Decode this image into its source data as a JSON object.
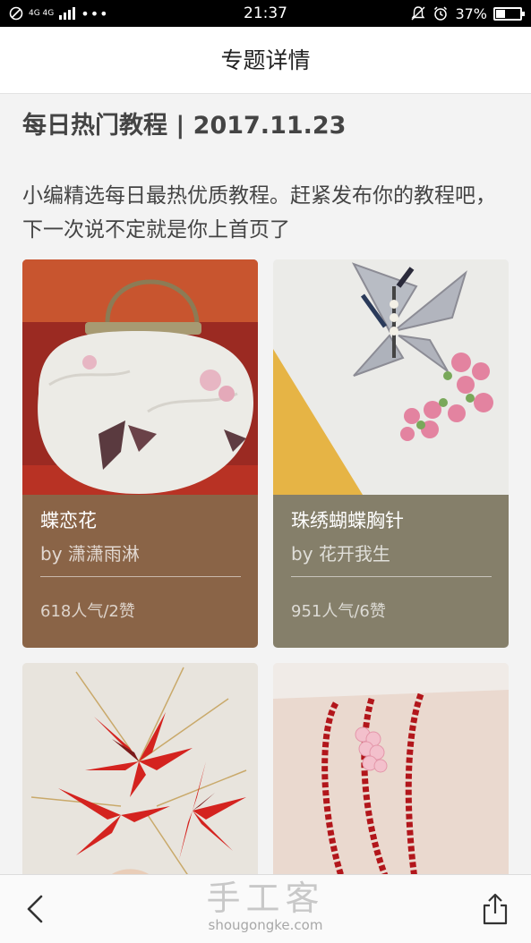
{
  "status_bar": {
    "network": "4G 4G",
    "time": "21:37",
    "battery": "37%",
    "battery_level": 0.37
  },
  "header": {
    "title": "专题详情",
    "back_icon": "chevron-left-icon",
    "share_icon": "share-icon"
  },
  "article": {
    "headline": "每日热门教程 | 2017.11.23",
    "intro": "小编精选每日最热优质教程。赶紧发布你的教程吧，下一次说不定就是你上首页了"
  },
  "cards": [
    {
      "title": "蝶恋花",
      "author": "by 潇潇雨淋",
      "stats": "618人气/2赞",
      "color": "#8a6447"
    },
    {
      "title": "珠绣蝴蝶胸针",
      "author": "by 花开我生",
      "stats": "951人气/6赞",
      "color": "#857f6a"
    },
    {
      "title": "",
      "author": "",
      "stats": "",
      "color": "#a33"
    },
    {
      "title": "",
      "author": "",
      "stats": "",
      "color": "#c62a2a"
    }
  ],
  "footer": {
    "logo_text": "手工客",
    "logo_url": "shougongke.com"
  }
}
